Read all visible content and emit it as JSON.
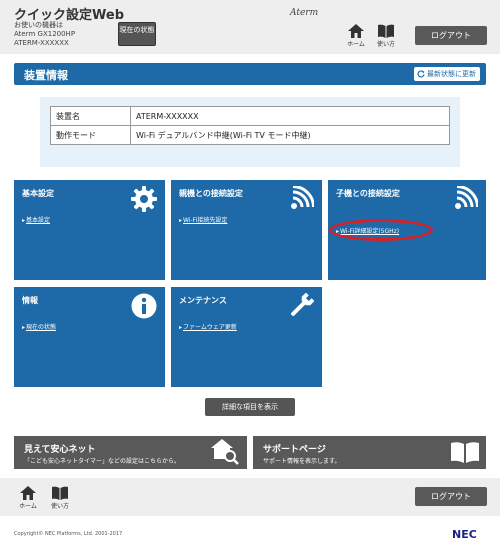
{
  "header": {
    "app_title": "クイック設定Web",
    "device_label": "お使いの機器は",
    "device_model": "Aterm GX1200HP",
    "device_id": "ATERM-XXXXXX",
    "status_button": "現在の状態",
    "brand": "Aterm",
    "home_label": "ホーム",
    "help_label": "使い方",
    "logout_label": "ログアウト"
  },
  "device_info": {
    "title": "装置情報",
    "refresh_label": "最新状態に更新",
    "rows": [
      {
        "key": "装置名",
        "value": "ATERM-XXXXXX"
      },
      {
        "key": "動作モード",
        "value": "Wi-Fi デュアルバンド中継(Wi-Fi TV モード中継)"
      }
    ]
  },
  "tiles": {
    "basic": {
      "title": "基本設定",
      "link": "基本設定"
    },
    "parent": {
      "title": "親機との接続設定",
      "link": "Wi-Fi接続先設定"
    },
    "child": {
      "title": "子機との接続設定",
      "link": "Wi-Fi詳細設定(5GHz)"
    },
    "info": {
      "title": "情報",
      "link": "現在の状態"
    },
    "maintenance": {
      "title": "メンテナンス",
      "link": "ファームウェア更新"
    }
  },
  "detail_button": "詳細な項目を表示",
  "promos": {
    "safety": {
      "title": "見えて安心ネット",
      "desc": "「こども安心ネットタイマー」などの設定はこちらから。"
    },
    "support": {
      "title": "サポートページ",
      "desc": "サポート情報を表示します。"
    }
  },
  "footer": {
    "home_label": "ホーム",
    "help_label": "使い方",
    "logout_label": "ログアウト",
    "copyright": "Copyright© NEC Platforms, Ltd. 2001-2017",
    "logo": "NEC"
  },
  "colors": {
    "accent": "#1e6aa8",
    "highlight": "#d81f26"
  }
}
